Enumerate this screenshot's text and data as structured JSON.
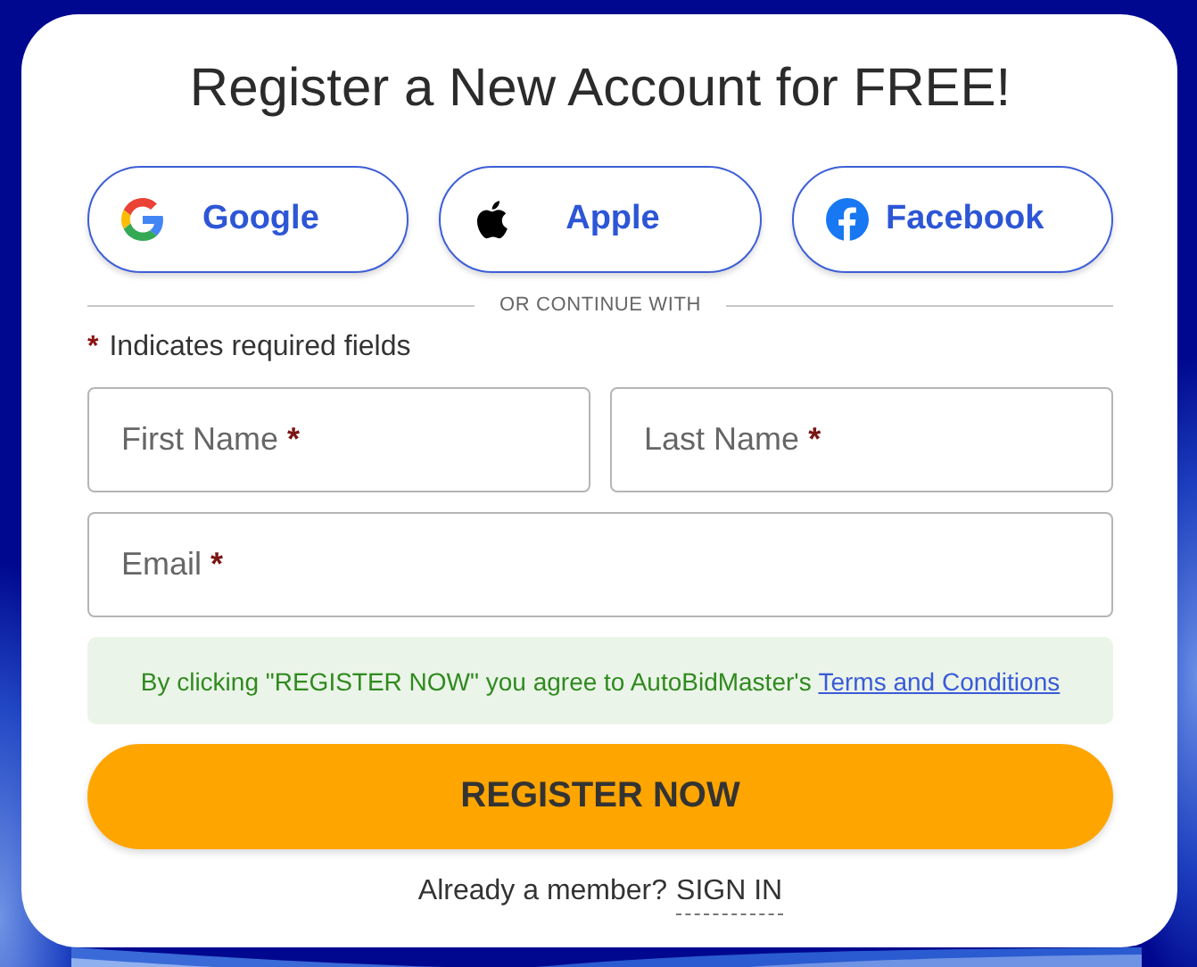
{
  "title": "Register a New Account for FREE!",
  "social_buttons": [
    {
      "kind": "google",
      "label": "Google"
    },
    {
      "kind": "apple",
      "label": "Apple"
    },
    {
      "kind": "facebook",
      "label": "Facebook"
    }
  ],
  "divider_text": "OR CONTINUE WITH",
  "required_note": {
    "mark": "*",
    "text": "Indicates required fields"
  },
  "field_rows": [
    [
      {
        "placeholder": "First Name",
        "mark": "*"
      },
      {
        "placeholder": "Last Name",
        "mark": "*"
      }
    ],
    [
      {
        "placeholder": "Email",
        "mark": "*"
      }
    ]
  ],
  "terms": {
    "text": "By clicking \"REGISTER NOW\" you agree to AutoBidMaster's",
    "link": "Terms and Conditions"
  },
  "register_button": "REGISTER NOW",
  "sign_in": {
    "text": "Already a member?",
    "link": "SIGN IN"
  }
}
